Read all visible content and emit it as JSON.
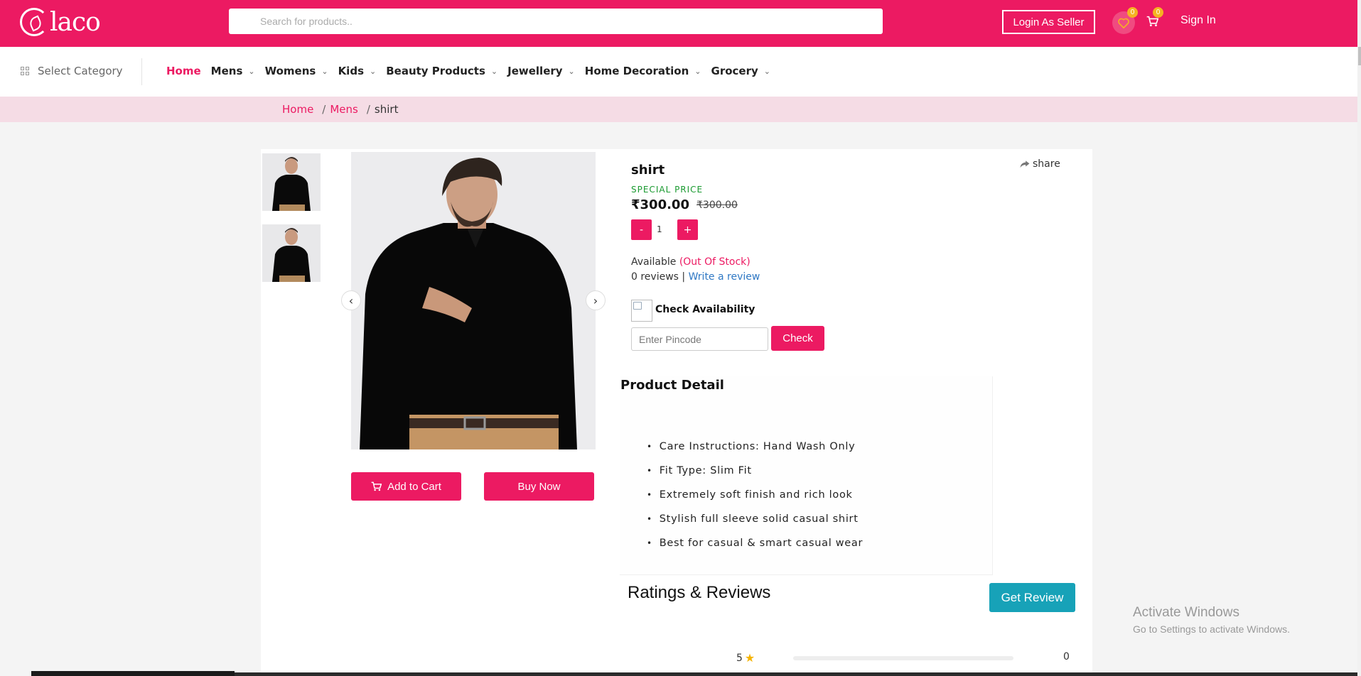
{
  "header": {
    "logo_text": "laco",
    "search_placeholder": "Search for products..",
    "login_seller_label": "Login As Seller",
    "wishlist_count": "0",
    "cart_count": "0",
    "sign_in_label": "Sign In",
    "brand_color": "#ec1a62"
  },
  "nav": {
    "select_category": "Select Category",
    "items": [
      {
        "label": "Home",
        "active": true,
        "has_dropdown": false
      },
      {
        "label": "Mens",
        "has_dropdown": true
      },
      {
        "label": "Womens",
        "has_dropdown": true
      },
      {
        "label": "Kids",
        "has_dropdown": true
      },
      {
        "label": "Beauty Products",
        "has_dropdown": true
      },
      {
        "label": "Jewellery",
        "has_dropdown": true
      },
      {
        "label": "Home Decoration",
        "has_dropdown": true
      },
      {
        "label": "Grocery",
        "has_dropdown": true
      }
    ]
  },
  "breadcrumb": {
    "items": [
      "Home",
      "Mens"
    ],
    "current": "shirt"
  },
  "product": {
    "title": "shirt",
    "share_label": "share",
    "special_price_label": "SPECIAL PRICE",
    "price": "₹300.00",
    "old_price": "₹300.00",
    "quantity": "1",
    "minus_label": "-",
    "plus_label": "+",
    "available_label": "Available",
    "stock_status": "(Out Of Stock)",
    "reviews_text": "0 reviews |",
    "write_review_label": "Write a review",
    "check_availability_label": "Check Availability",
    "pincode_placeholder": "Enter Pincode",
    "check_label": "Check",
    "add_to_cart_label": "Add to Cart",
    "buy_now_label": "Buy Now",
    "prev_arrow": "‹",
    "next_arrow": "›"
  },
  "details": {
    "title": "Product Detail",
    "bullets": [
      "Care Instructions: Hand Wash Only",
      "Fit Type: Slim Fit",
      "Extremely soft finish and rich look",
      "Stylish full sleeve solid casual shirt",
      "Best for casual & smart casual wear"
    ]
  },
  "ratings": {
    "title": "Ratings & Reviews",
    "get_review_label": "Get Review",
    "rows": [
      {
        "stars": "5",
        "count": "0"
      }
    ]
  },
  "windows": {
    "activate_title": "Activate Windows",
    "activate_sub": "Go to Settings to activate Windows."
  }
}
